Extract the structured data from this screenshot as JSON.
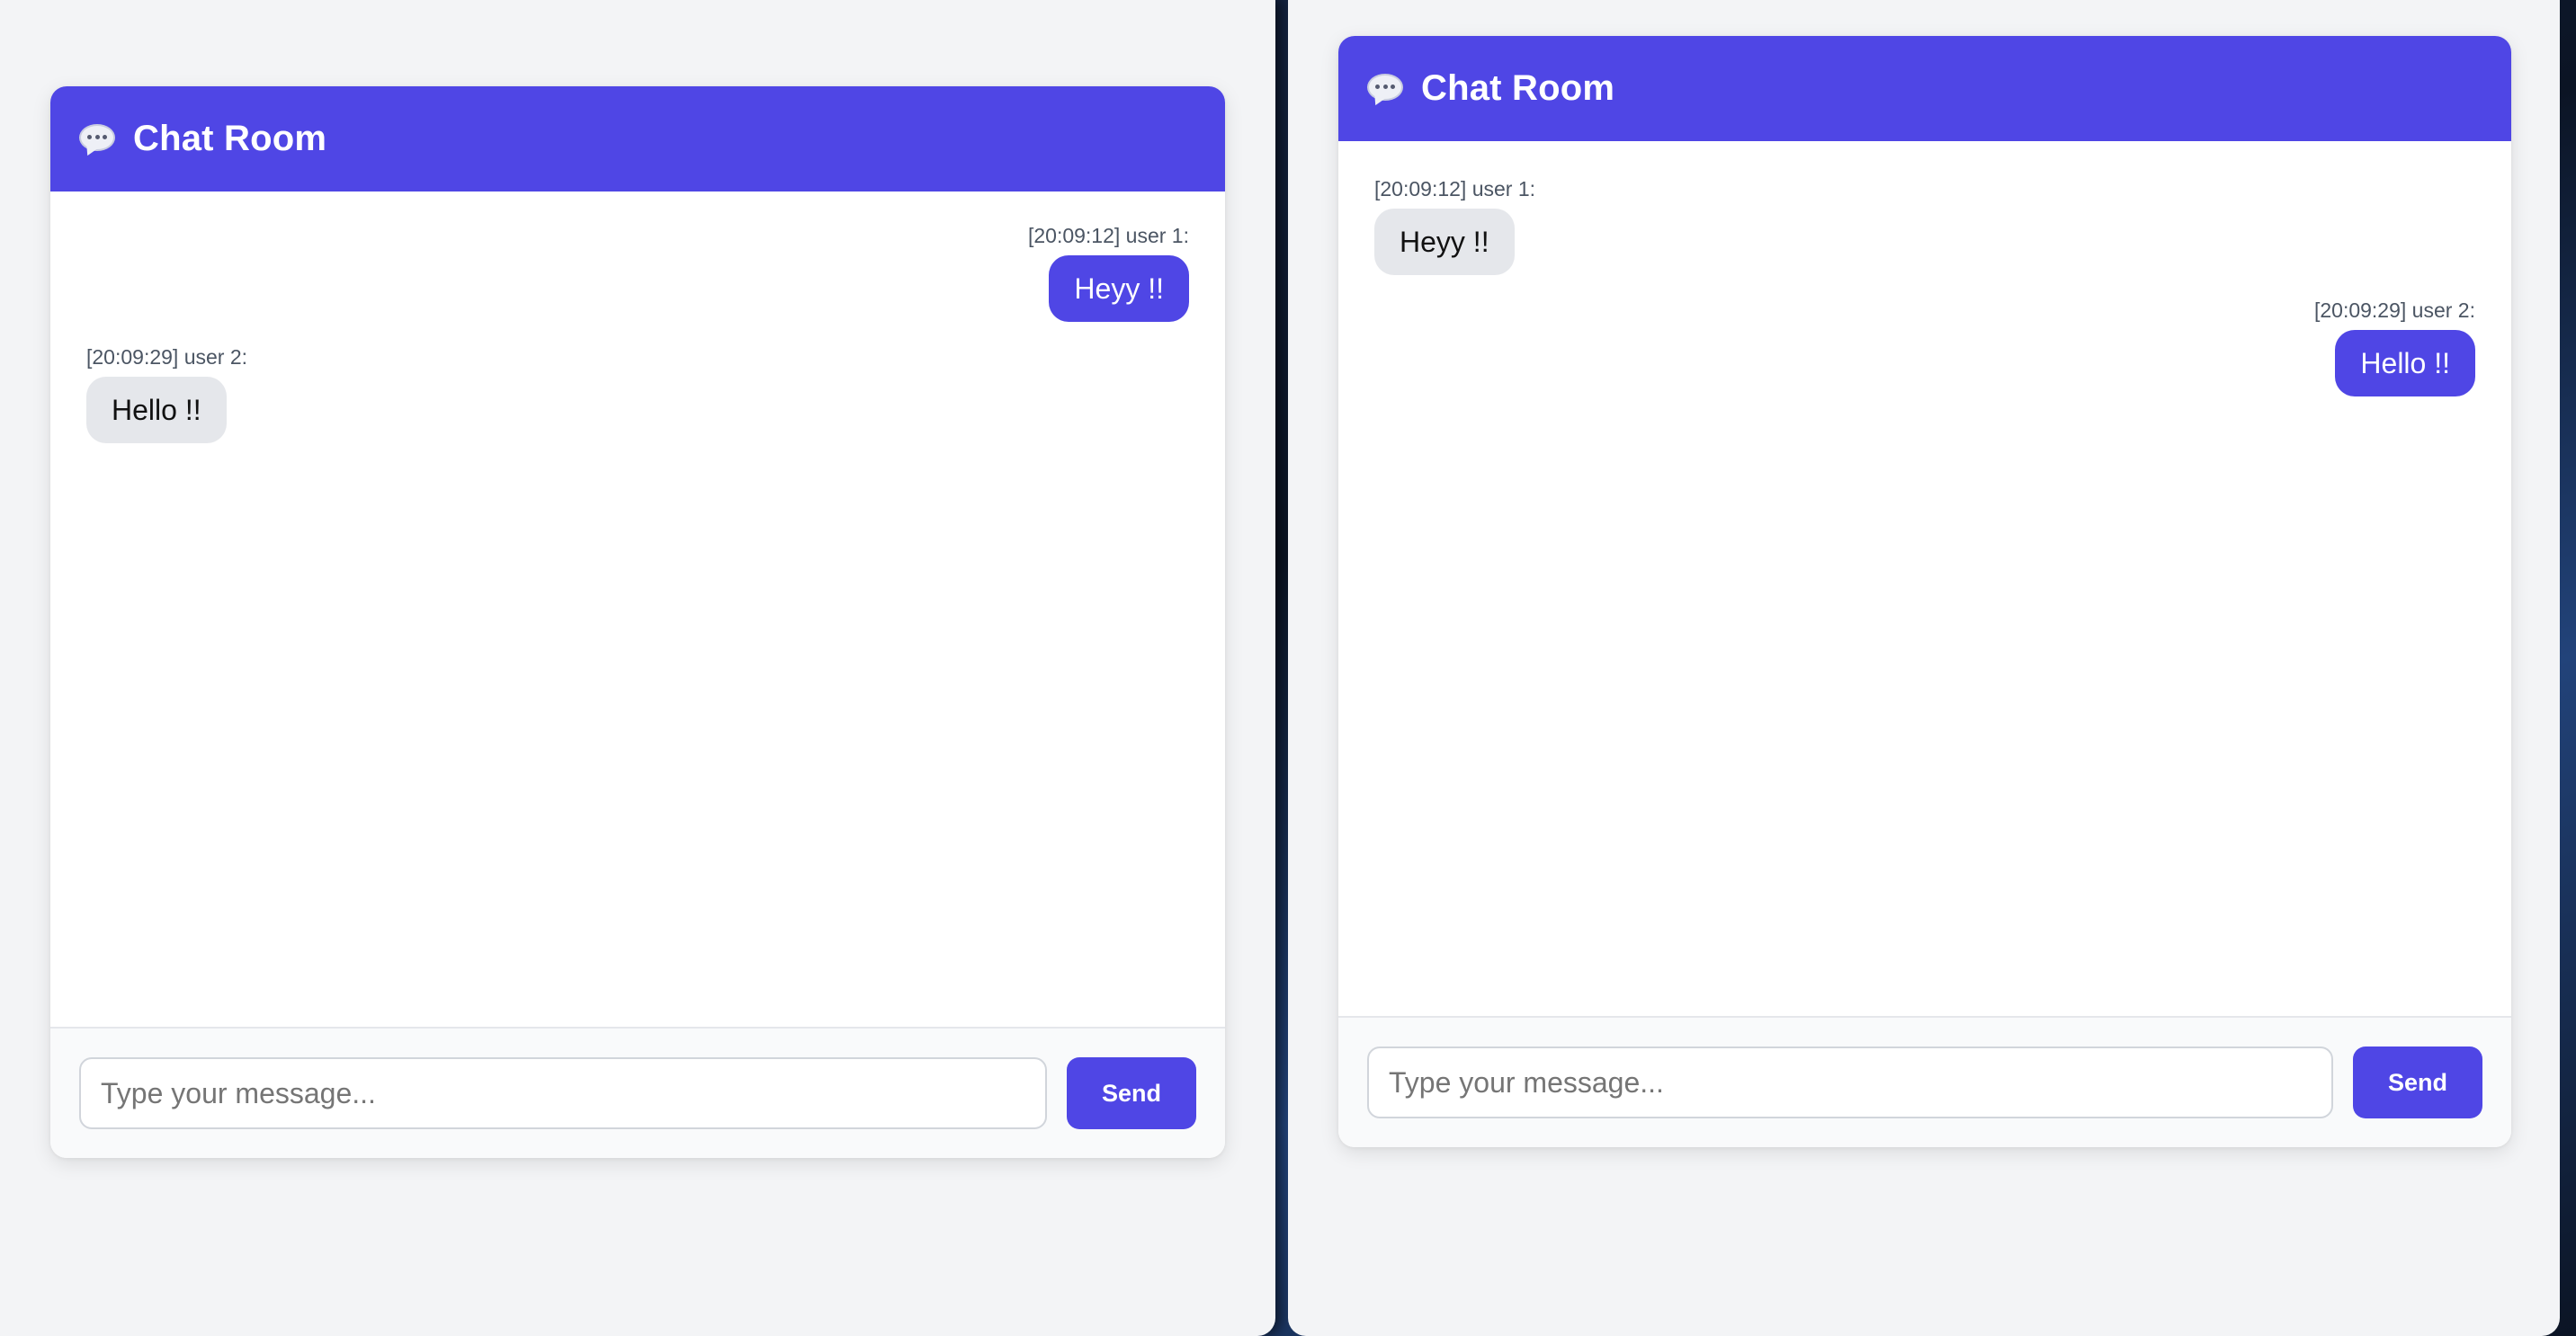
{
  "windows": [
    {
      "chat": {
        "title": "Chat Room",
        "header_icon": "speech-bubble-icon",
        "messages": [
          {
            "time": "[20:09:12]",
            "sender": "user 1:",
            "text": "Heyy !!",
            "side": "mine"
          },
          {
            "time": "[20:09:29]",
            "sender": "user 2:",
            "text": "Hello !!",
            "side": "theirs"
          }
        ],
        "input_placeholder": "Type your message...",
        "send_label": "Send"
      }
    },
    {
      "chat": {
        "title": "Chat Room",
        "header_icon": "speech-bubble-icon",
        "messages": [
          {
            "time": "[20:09:12]",
            "sender": "user 1:",
            "text": "Heyy !!",
            "side": "theirs"
          },
          {
            "time": "[20:09:29]",
            "sender": "user 2:",
            "text": "Hello !!",
            "side": "mine"
          }
        ],
        "input_placeholder": "Type your message...",
        "send_label": "Send"
      }
    }
  ],
  "colors": {
    "accent": "#4f46e5",
    "incoming_bubble": "#e5e7eb",
    "page_background": "#f3f4f6"
  }
}
